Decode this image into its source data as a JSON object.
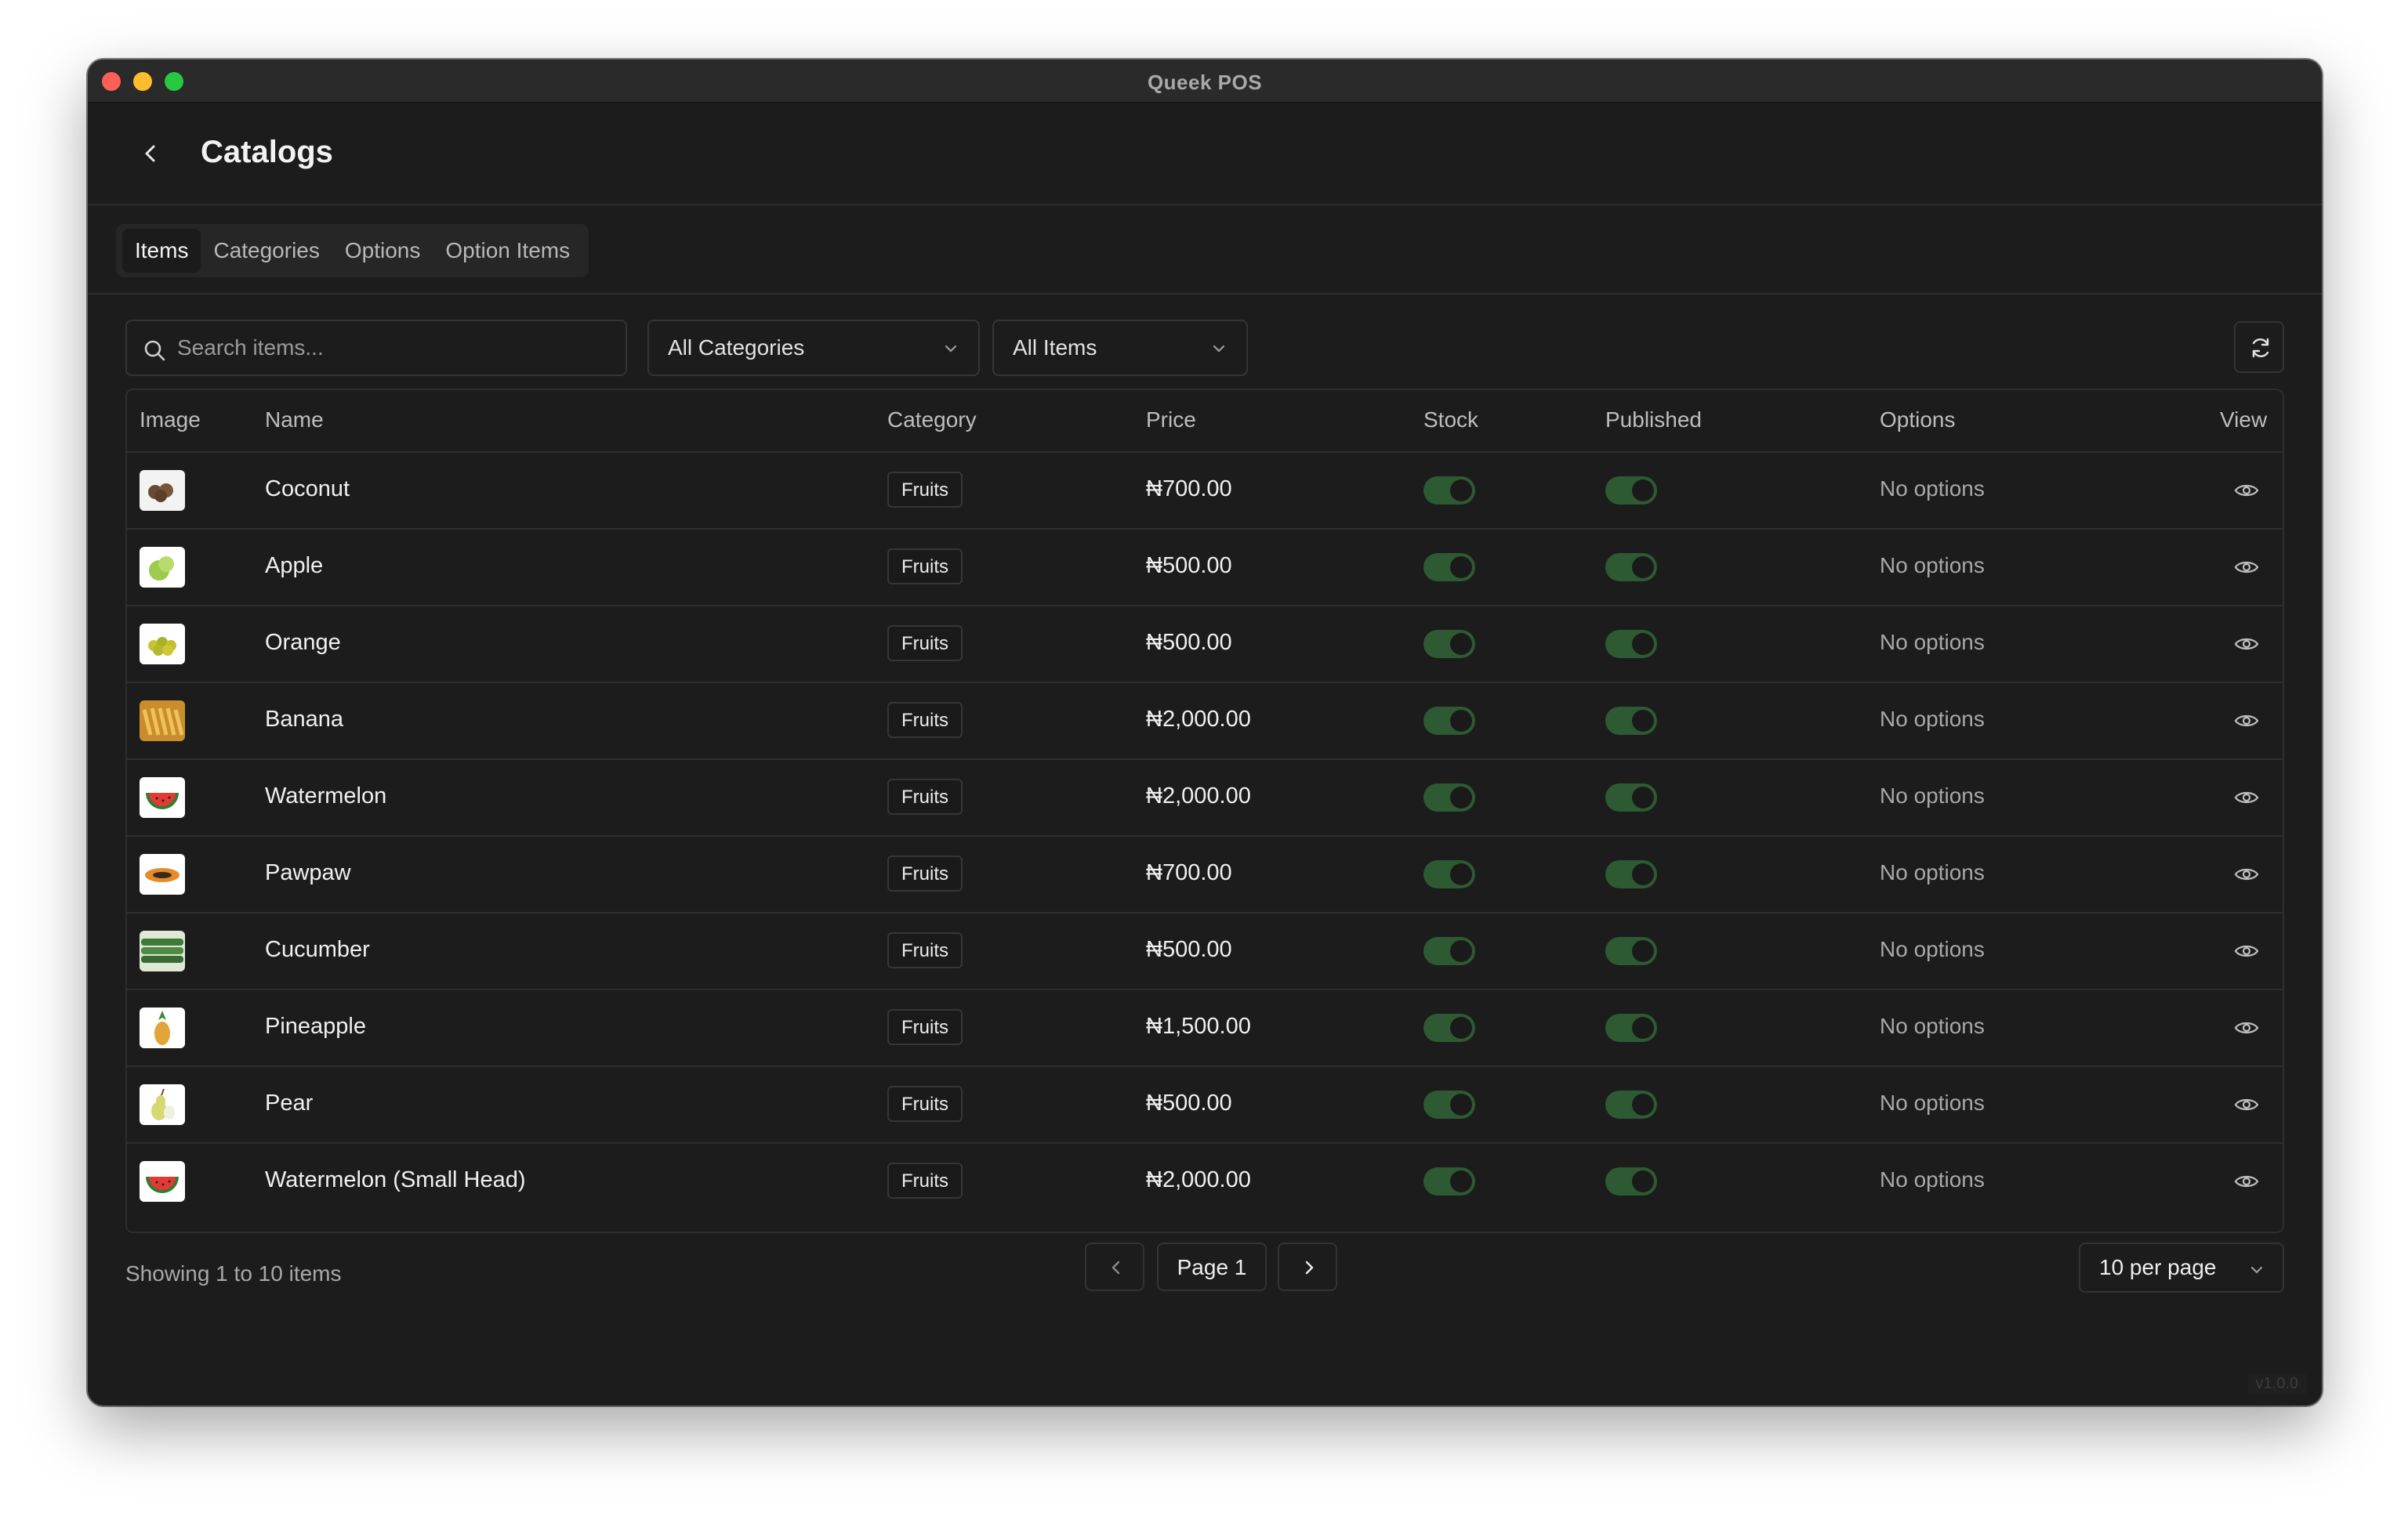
{
  "window": {
    "title": "Queek POS",
    "version": "v1.0.0"
  },
  "header": {
    "title": "Catalogs"
  },
  "tabs": [
    {
      "label": "Items",
      "active": true
    },
    {
      "label": "Categories",
      "active": false
    },
    {
      "label": "Options",
      "active": false
    },
    {
      "label": "Option Items",
      "active": false
    }
  ],
  "toolbar": {
    "search_placeholder": "Search items...",
    "search_value": "",
    "category_filter": "All Categories",
    "items_filter": "All Items"
  },
  "table": {
    "columns": [
      "Image",
      "Name",
      "Category",
      "Price",
      "Stock",
      "Published",
      "Options",
      "View"
    ],
    "rows": [
      {
        "name": "Coconut",
        "category": "Fruits",
        "price": "₦700.00",
        "stock": true,
        "published": true,
        "options": "No options",
        "thumb": "coconut"
      },
      {
        "name": "Apple",
        "category": "Fruits",
        "price": "₦500.00",
        "stock": true,
        "published": true,
        "options": "No options",
        "thumb": "apple"
      },
      {
        "name": "Orange",
        "category": "Fruits",
        "price": "₦500.00",
        "stock": true,
        "published": true,
        "options": "No options",
        "thumb": "orange"
      },
      {
        "name": "Banana",
        "category": "Fruits",
        "price": "₦2,000.00",
        "stock": true,
        "published": true,
        "options": "No options",
        "thumb": "banana"
      },
      {
        "name": "Watermelon",
        "category": "Fruits",
        "price": "₦2,000.00",
        "stock": true,
        "published": true,
        "options": "No options",
        "thumb": "watermelon"
      },
      {
        "name": "Pawpaw",
        "category": "Fruits",
        "price": "₦700.00",
        "stock": true,
        "published": true,
        "options": "No options",
        "thumb": "pawpaw"
      },
      {
        "name": "Cucumber",
        "category": "Fruits",
        "price": "₦500.00",
        "stock": true,
        "published": true,
        "options": "No options",
        "thumb": "cucumber"
      },
      {
        "name": "Pineapple",
        "category": "Fruits",
        "price": "₦1,500.00",
        "stock": true,
        "published": true,
        "options": "No options",
        "thumb": "pineapple"
      },
      {
        "name": "Pear",
        "category": "Fruits",
        "price": "₦500.00",
        "stock": true,
        "published": true,
        "options": "No options",
        "thumb": "pear"
      },
      {
        "name": "Watermelon (Small Head)",
        "category": "Fruits",
        "price": "₦2,000.00",
        "stock": true,
        "published": true,
        "options": "No options",
        "thumb": "watermelon"
      }
    ]
  },
  "pagination": {
    "showing": "Showing 1 to 10 items",
    "page_label": "Page 1",
    "per_page": "10 per page"
  },
  "colors": {
    "background": "#1c1c1c",
    "toggle_on": "#2d5a33",
    "text": "#f0f0f0",
    "muted": "#a8a8a8"
  }
}
